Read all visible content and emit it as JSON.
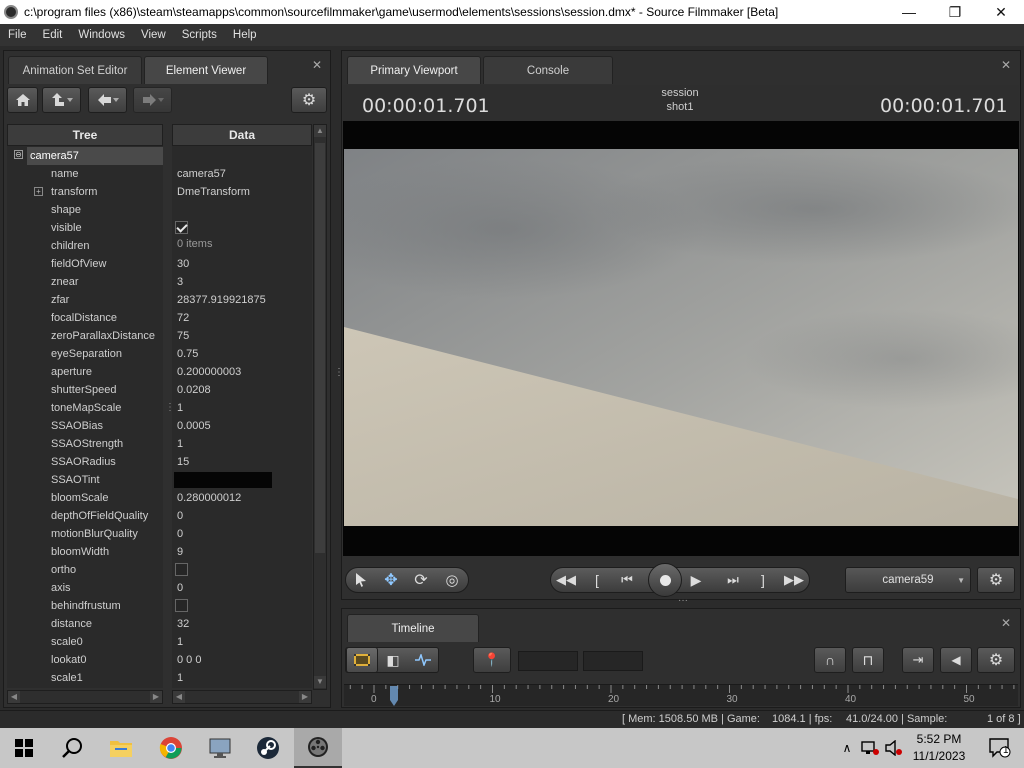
{
  "window": {
    "title": "c:\\program files (x86)\\steam\\steamapps\\common\\sourcefilmmaker\\game\\usermod\\elements\\sessions\\session.dmx* - Source Filmmaker [Beta]",
    "minimize": "—",
    "maximize": "❐",
    "close": "✕"
  },
  "menu": [
    "File",
    "Edit",
    "Windows",
    "View",
    "Scripts",
    "Help"
  ],
  "left_panel": {
    "tabs": [
      "Animation Set Editor",
      "Element Viewer"
    ],
    "active_tab": 1,
    "close_glyph": "✕",
    "columns": [
      "Tree",
      "Data"
    ],
    "root": {
      "name": "camera57",
      "toggle": "⊖"
    },
    "rows": [
      {
        "name": "name",
        "value": "camera57",
        "kind": "text"
      },
      {
        "name": "transform",
        "value": "DmeTransform",
        "kind": "text",
        "expandable": true
      },
      {
        "name": "shape",
        "value": "",
        "kind": "text"
      },
      {
        "name": "visible",
        "value": true,
        "kind": "check"
      },
      {
        "name": "children",
        "value": "0 items",
        "kind": "text"
      },
      {
        "name": "fieldOfView",
        "value": "30",
        "kind": "text"
      },
      {
        "name": "znear",
        "value": "3",
        "kind": "text"
      },
      {
        "name": "zfar",
        "value": "28377.919921875",
        "kind": "text"
      },
      {
        "name": "focalDistance",
        "value": "72",
        "kind": "text"
      },
      {
        "name": "zeroParallaxDistance",
        "value": "75",
        "kind": "text"
      },
      {
        "name": "eyeSeparation",
        "value": "0.75",
        "kind": "text"
      },
      {
        "name": "aperture",
        "value": "0.200000003",
        "kind": "text"
      },
      {
        "name": "shutterSpeed",
        "value": "0.0208",
        "kind": "text"
      },
      {
        "name": "toneMapScale",
        "value": "1",
        "kind": "text"
      },
      {
        "name": "SSAOBias",
        "value": "0.0005",
        "kind": "text"
      },
      {
        "name": "SSAOStrength",
        "value": "1",
        "kind": "text"
      },
      {
        "name": "SSAORadius",
        "value": "15",
        "kind": "text"
      },
      {
        "name": "SSAOTint",
        "value": "#050505",
        "kind": "color"
      },
      {
        "name": "bloomScale",
        "value": "0.280000012",
        "kind": "text"
      },
      {
        "name": "depthOfFieldQuality",
        "value": "0",
        "kind": "text"
      },
      {
        "name": "motionBlurQuality",
        "value": "0",
        "kind": "text"
      },
      {
        "name": "bloomWidth",
        "value": "9",
        "kind": "text"
      },
      {
        "name": "ortho",
        "value": false,
        "kind": "check"
      },
      {
        "name": "axis",
        "value": "0",
        "kind": "text"
      },
      {
        "name": "behindfrustum",
        "value": false,
        "kind": "check"
      },
      {
        "name": "distance",
        "value": "32",
        "kind": "text"
      },
      {
        "name": "scale0",
        "value": "1",
        "kind": "text"
      },
      {
        "name": "lookat0",
        "value": "0 0 0",
        "kind": "text"
      },
      {
        "name": "scale1",
        "value": "1",
        "kind": "text"
      }
    ]
  },
  "viewport": {
    "tabs": [
      "Primary Viewport",
      "Console"
    ],
    "active_tab": 0,
    "close_glyph": "✕",
    "timecode_left": "00:00:01.701",
    "timecode_right": "00:00:01.701",
    "session": "session",
    "shot": "shot1",
    "camera_dropdown": "camera59",
    "sky_colors": [
      "#7f8285",
      "#a3a4a1",
      "#c7c5bc"
    ],
    "ground_colors": [
      "#cdc6b6",
      "#b9b3a4"
    ]
  },
  "timeline": {
    "tab": "Timeline",
    "close_glyph": "✕",
    "ruler_labels": [
      "0",
      "10",
      "20",
      "30",
      "40",
      "50"
    ],
    "playhead": 1.701
  },
  "status": {
    "mem": "[ Mem:  1508.50 MB | Game:",
    "game": "1084.1 | fps:",
    "fps": "41.0/24.00 | Sample:",
    "sample": "1 of 8 ]"
  },
  "taskbar": {
    "time": "5:52 PM",
    "date": "11/1/2023",
    "notification_count": "1"
  }
}
